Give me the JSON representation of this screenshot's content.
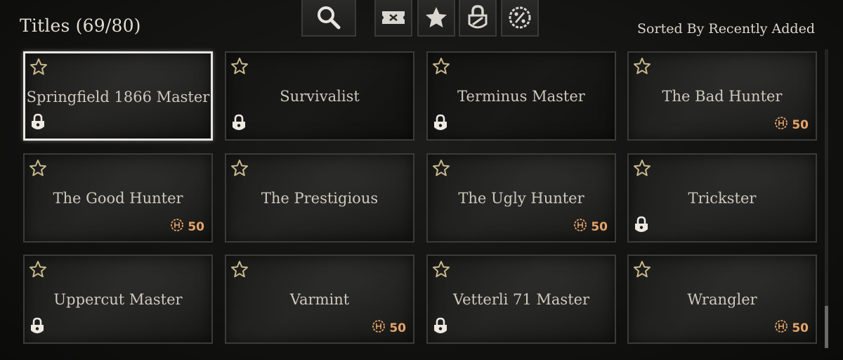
{
  "header": {
    "title": "Titles (69/80)",
    "sort_label": "Sorted By Recently Added"
  },
  "toolbar": {
    "buttons": [
      {
        "icon": "search-icon"
      },
      {
        "icon": "ticket-icon"
      },
      {
        "icon": "star-icon"
      },
      {
        "icon": "lock-filter-icon"
      },
      {
        "icon": "discount-icon"
      }
    ]
  },
  "colors": {
    "cost_accent": "#e7a46a",
    "star_outline": "#c9b98c",
    "selected_border": "#e9e6df"
  },
  "cards": [
    {
      "name": "Springfield 1866 Master",
      "locked": true,
      "cost": "",
      "selected": true
    },
    {
      "name": "Survivalist",
      "locked": true,
      "cost": "",
      "selected": false
    },
    {
      "name": "Terminus Master",
      "locked": true,
      "cost": "",
      "selected": false
    },
    {
      "name": "The Bad Hunter",
      "locked": false,
      "cost": "50",
      "selected": false
    },
    {
      "name": "The Good Hunter",
      "locked": false,
      "cost": "50",
      "selected": false
    },
    {
      "name": "The Prestigious",
      "locked": false,
      "cost": "",
      "selected": false
    },
    {
      "name": "The Ugly Hunter",
      "locked": false,
      "cost": "50",
      "selected": false
    },
    {
      "name": "Trickster",
      "locked": true,
      "cost": "",
      "selected": false
    },
    {
      "name": "Uppercut Master",
      "locked": true,
      "cost": "",
      "selected": false
    },
    {
      "name": "Varmint",
      "locked": false,
      "cost": "50",
      "selected": false
    },
    {
      "name": "Vetterli 71 Master",
      "locked": true,
      "cost": "",
      "selected": false
    },
    {
      "name": "Wrangler",
      "locked": false,
      "cost": "50",
      "selected": false
    }
  ]
}
